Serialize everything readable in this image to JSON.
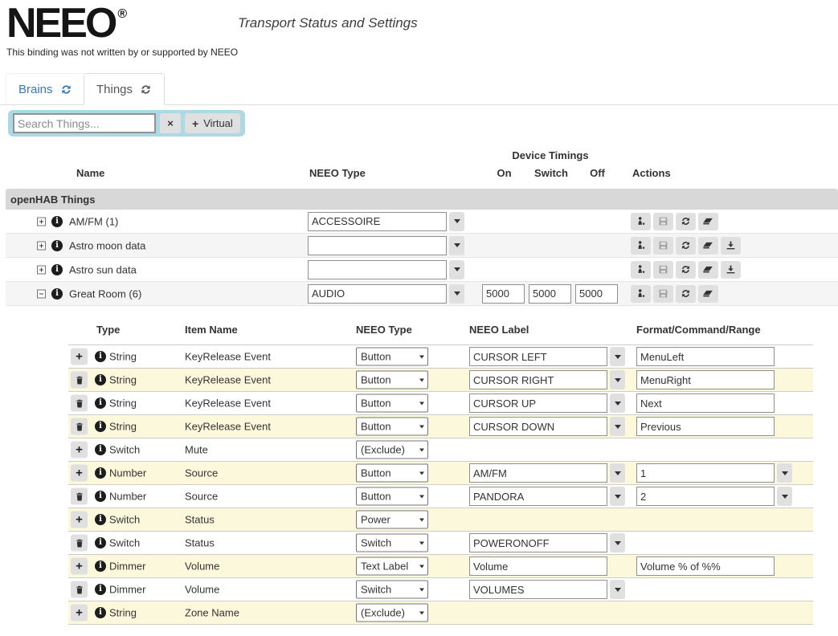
{
  "header": {
    "logo_text": "NEEO",
    "registered_mark": "®",
    "subtitle": "Transport Status and Settings",
    "disclaimer": "This binding was not written by or supported by NEEO"
  },
  "tabs": {
    "brains": {
      "label": "Brains"
    },
    "things": {
      "label": "Things"
    }
  },
  "search": {
    "placeholder": "Search Things...",
    "clear_label": "×",
    "virtual_plus": "+",
    "virtual_label": "Virtual"
  },
  "things_table": {
    "group_header": "Device Timings",
    "columns": {
      "name": "Name",
      "neeo_type": "NEEO Type",
      "on": "On",
      "switch": "Switch",
      "off": "Off",
      "actions": "Actions"
    },
    "section_label": "openHAB Things",
    "rows": [
      {
        "name": "AM/FM (1)",
        "neeo_type": "ACCESSOIRE"
      },
      {
        "name": "Astro moon data",
        "neeo_type": ""
      },
      {
        "name": "Astro sun data",
        "neeo_type": ""
      },
      {
        "name": "Great Room (6)",
        "neeo_type": "AUDIO",
        "timings": {
          "on": "5000",
          "switch": "5000",
          "off": "5000"
        }
      }
    ]
  },
  "channels_table": {
    "columns": {
      "type": "Type",
      "item_name": "Item Name",
      "neeo_type": "NEEO Type",
      "neeo_label": "NEEO Label",
      "format": "Format/Command/Range"
    },
    "rows": [
      {
        "type": "String",
        "item_name": "KeyRelease Event",
        "neeo_type": "Button",
        "neeo_label": "CURSOR LEFT",
        "format": "MenuLeft"
      },
      {
        "type": "String",
        "item_name": "KeyRelease Event",
        "neeo_type": "Button",
        "neeo_label": "CURSOR RIGHT",
        "format": "MenuRight"
      },
      {
        "type": "String",
        "item_name": "KeyRelease Event",
        "neeo_type": "Button",
        "neeo_label": "CURSOR UP",
        "format": "Next"
      },
      {
        "type": "String",
        "item_name": "KeyRelease Event",
        "neeo_type": "Button",
        "neeo_label": "CURSOR DOWN",
        "format": "Previous"
      },
      {
        "type": "Switch",
        "item_name": "Mute",
        "neeo_type": "(Exclude)"
      },
      {
        "type": "Number",
        "item_name": "Source",
        "neeo_type": "Button",
        "neeo_label": "AM/FM",
        "format": "1"
      },
      {
        "type": "Number",
        "item_name": "Source",
        "neeo_type": "Button",
        "neeo_label": "PANDORA",
        "format": "2"
      },
      {
        "type": "Switch",
        "item_name": "Status",
        "neeo_type": "Power"
      },
      {
        "type": "Switch",
        "item_name": "Status",
        "neeo_type": "Switch",
        "neeo_label": "POWERONOFF"
      },
      {
        "type": "Dimmer",
        "item_name": "Volume",
        "neeo_type": "Text Label",
        "neeo_label": "Volume",
        "format": "Volume % of %%"
      },
      {
        "type": "Dimmer",
        "item_name": "Volume",
        "neeo_type": "Switch",
        "neeo_label": "VOLUMES"
      },
      {
        "type": "String",
        "item_name": "Zone Name",
        "neeo_type": "(Exclude)"
      }
    ]
  },
  "colors": {
    "link_blue": "#337ab7",
    "search_bar_bg": "#add8e6",
    "section_band_bg": "#d8d8d8",
    "warning_row_bg": "#fbf8dc"
  }
}
